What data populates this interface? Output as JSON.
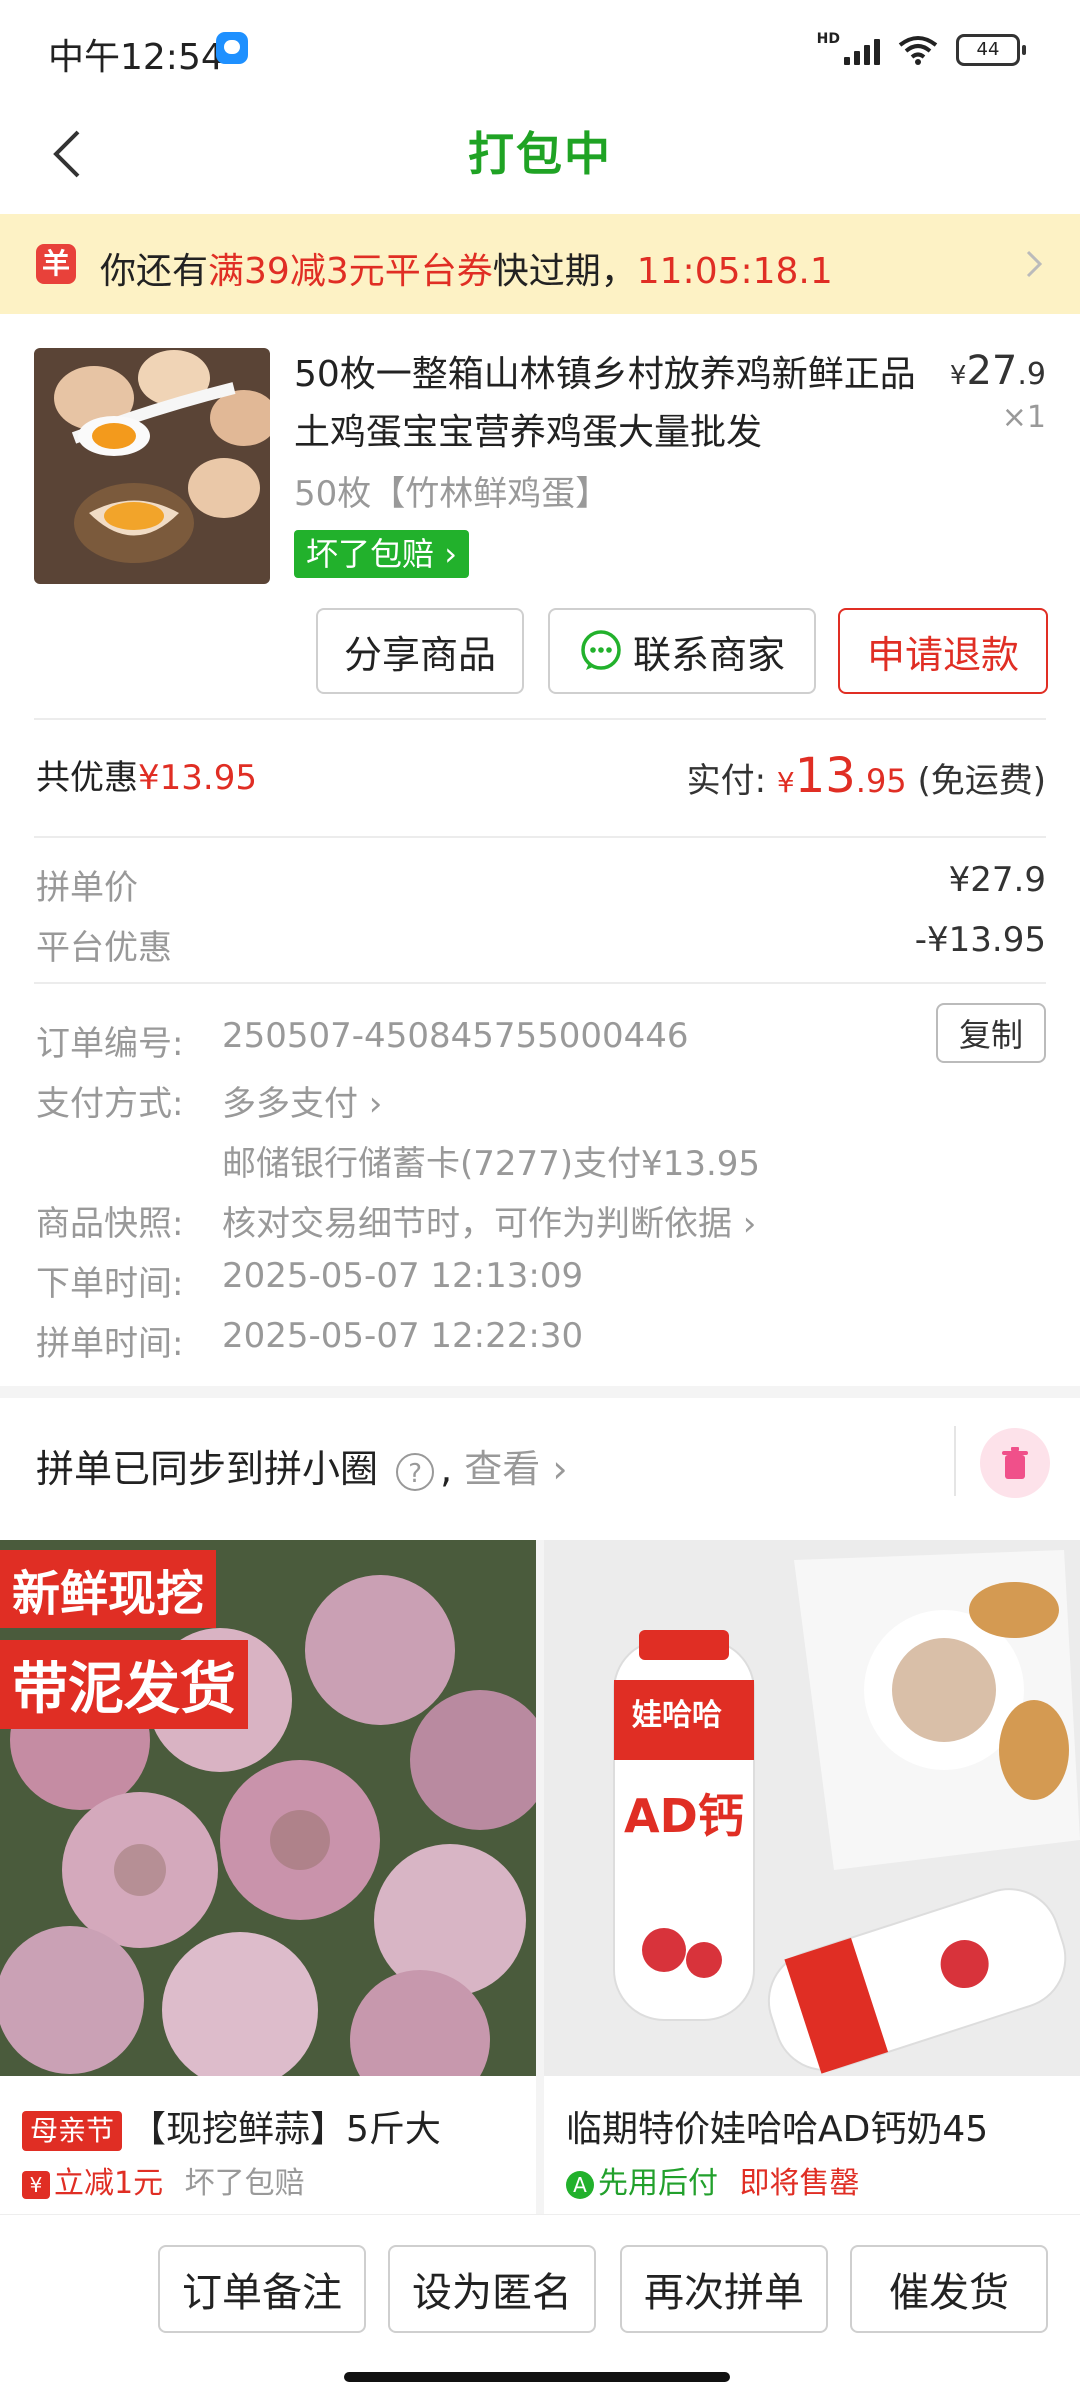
{
  "status_bar": {
    "time": "中午12:54",
    "network": "HD",
    "battery": "44"
  },
  "header": {
    "title": "打包中"
  },
  "coupon_banner": {
    "icon_text": "羊",
    "prefix": "你还有",
    "coupon": "满39减3元平台券",
    "middle": "快过期，",
    "countdown": "11:05:18.1"
  },
  "product": {
    "title": "50枚一整箱山林镇乡村放养鸡新鲜正品土鸡蛋宝宝营养鸡蛋大量批发",
    "price_symbol": "¥",
    "price_int": "27",
    "price_dec": ".9",
    "quantity": "×1",
    "spec": "50枚【竹林鲜鸡蛋】",
    "guarantee": "坏了包赔"
  },
  "actions": {
    "share": "分享商品",
    "contact": "联系商家",
    "refund": "申请退款"
  },
  "summary": {
    "discount_label": "共优惠",
    "discount_value": "¥13.95",
    "paid_label": "实付:",
    "paid_symbol": "¥",
    "paid_int": "13",
    "paid_dec": ".95",
    "shipping": "(免运费)"
  },
  "price_detail": [
    {
      "label": "拼单价",
      "value": "¥27.9"
    },
    {
      "label": "平台优惠",
      "value": "-¥13.95"
    }
  ],
  "order_info": {
    "order_no_label": "订单编号:",
    "order_no": "250507-450845755000446",
    "copy": "复制",
    "payment_label": "支付方式:",
    "payment_method": "多多支付",
    "payment_detail": "邮储银行储蓄卡(7277)支付¥13.95",
    "snapshot_label": "商品快照:",
    "snapshot_text": "核对交易细节时，可作为判断依据",
    "order_time_label": "下单时间:",
    "order_time": "2025-05-07 12:13:09",
    "group_time_label": "拼单时间:",
    "group_time": "2025-05-07 12:22:30"
  },
  "sync": {
    "text": "拼单已同步到拼小圈",
    "help": "?",
    "separator": ",",
    "view": "查看"
  },
  "recommendations": [
    {
      "tag_top": "新鲜现挖",
      "tag_bottom": "带泥发货",
      "festival": "母亲节",
      "title": "【现挖鲜蒜】5斤大",
      "badge": "¥",
      "promo": "立减1元",
      "guarantee": "坏了包赔"
    },
    {
      "title": "临期特价娃哈哈AD钙奶45",
      "badge": "A",
      "promo": "先用后付",
      "status": "即将售罄",
      "brand_text": "娃哈哈",
      "product_text": "AD钙"
    }
  ],
  "bottom_actions": {
    "note": "订单备注",
    "anonymous": "设为匿名",
    "regroup": "再次拼单",
    "urge": "催发货"
  },
  "colors": {
    "brand_green": "#1fa324",
    "accent_red": "#e02e24",
    "banner_bg": "#fdf2c5"
  }
}
